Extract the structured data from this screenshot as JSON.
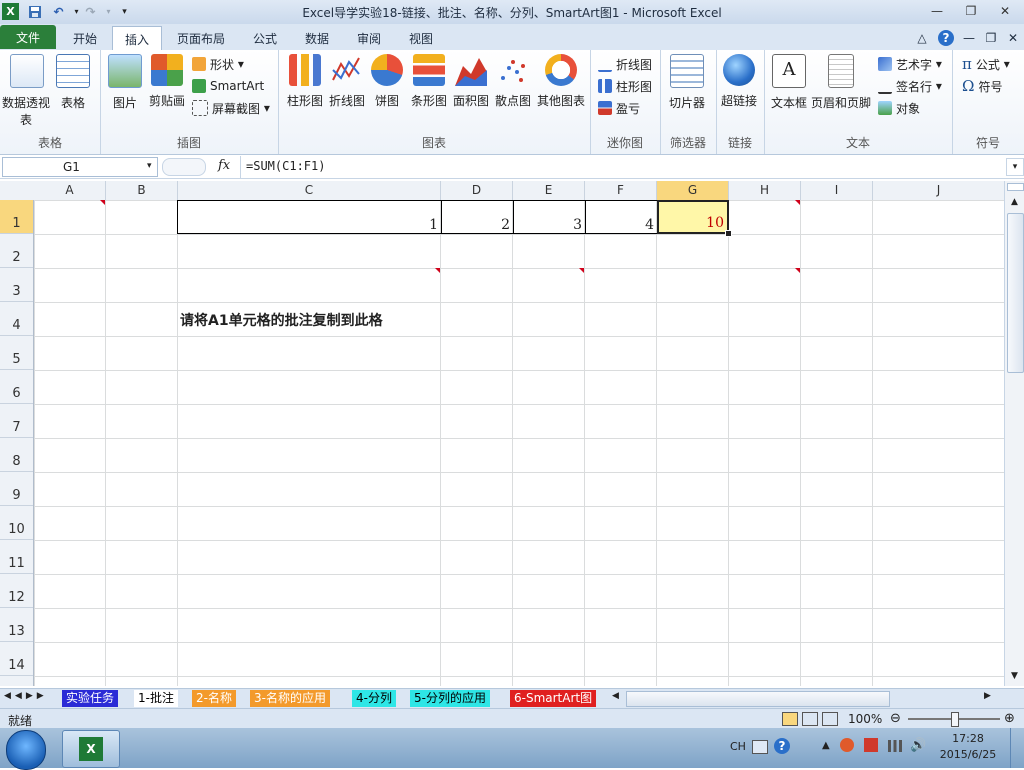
{
  "window": {
    "title": "Excel导学实验18-链接、批注、名称、分列、SmartArt图1 - Microsoft Excel",
    "app_icon": "excel-icon"
  },
  "tabs": [
    "文件",
    "开始",
    "插入",
    "页面布局",
    "公式",
    "数据",
    "审阅",
    "视图"
  ],
  "active_tab": "插入",
  "ribbon": {
    "groups": [
      {
        "label": "表格",
        "buttons": [
          "数据透视表",
          "表格"
        ]
      },
      {
        "label": "插图",
        "buttons": [
          "图片",
          "剪贴画"
        ],
        "small": [
          "形状",
          "SmartArt",
          "屏幕截图"
        ]
      },
      {
        "label": "图表",
        "buttons": [
          "柱形图",
          "折线图",
          "饼图",
          "条形图",
          "面积图",
          "散点图",
          "其他图表"
        ]
      },
      {
        "label": "迷你图",
        "small": [
          "折线图",
          "柱形图",
          "盈亏"
        ]
      },
      {
        "label": "筛选器",
        "buttons": [
          "切片器"
        ]
      },
      {
        "label": "链接",
        "buttons": [
          "超链接"
        ]
      },
      {
        "label": "文本",
        "buttons": [
          "文本框",
          "页眉和页脚"
        ],
        "small": [
          "艺术字",
          "签名行",
          "对象"
        ]
      },
      {
        "label": "符号",
        "small": [
          "公式",
          "符号"
        ]
      }
    ]
  },
  "formula_bar": {
    "name_box": "G1",
    "fx": "fx",
    "formula": "=SUM(C1:F1)"
  },
  "columns": [
    "A",
    "B",
    "C",
    "D",
    "E",
    "F",
    "G",
    "H",
    "I",
    "J"
  ],
  "selected_column": "G",
  "rows": [
    "1",
    "2",
    "3",
    "4",
    "5",
    "6",
    "7",
    "8",
    "9",
    "10",
    "11",
    "12",
    "13",
    "14"
  ],
  "selected_row": "1",
  "cells": {
    "C1": "1",
    "D1": "2",
    "E1": "3",
    "F1": "4",
    "G1": "10",
    "C4": "请将A1单元格的批注复制到此格"
  },
  "sheet_tabs": [
    {
      "label": "实验任务",
      "color": "#2b2bd6",
      "text_color": "#ffffff"
    },
    {
      "label": "1-批注",
      "color": "#ffffff",
      "text_color": "#000000"
    },
    {
      "label": "2-名称",
      "color": "#f39a2b",
      "text_color": "#ffffff"
    },
    {
      "label": "3-名称的应用",
      "color": "#f39a2b",
      "text_color": "#ffffff"
    },
    {
      "label": "4-分列",
      "color": "#2ee6e6",
      "text_color": "#000000"
    },
    {
      "label": "5-分列的应用",
      "color": "#2ee6e6",
      "text_color": "#000000"
    },
    {
      "label": "6-SmartArt图",
      "color": "#e02020",
      "text_color": "#ffffff"
    }
  ],
  "status": {
    "ready": "就绪",
    "zoom": "100%"
  },
  "taskbar": {
    "lang": "CH",
    "time": "17:28",
    "date": "2015/6/25"
  },
  "colors": {
    "accent": "#2b7f3a",
    "selection": "#f9d77e",
    "comment_marker": "#d0021b"
  }
}
